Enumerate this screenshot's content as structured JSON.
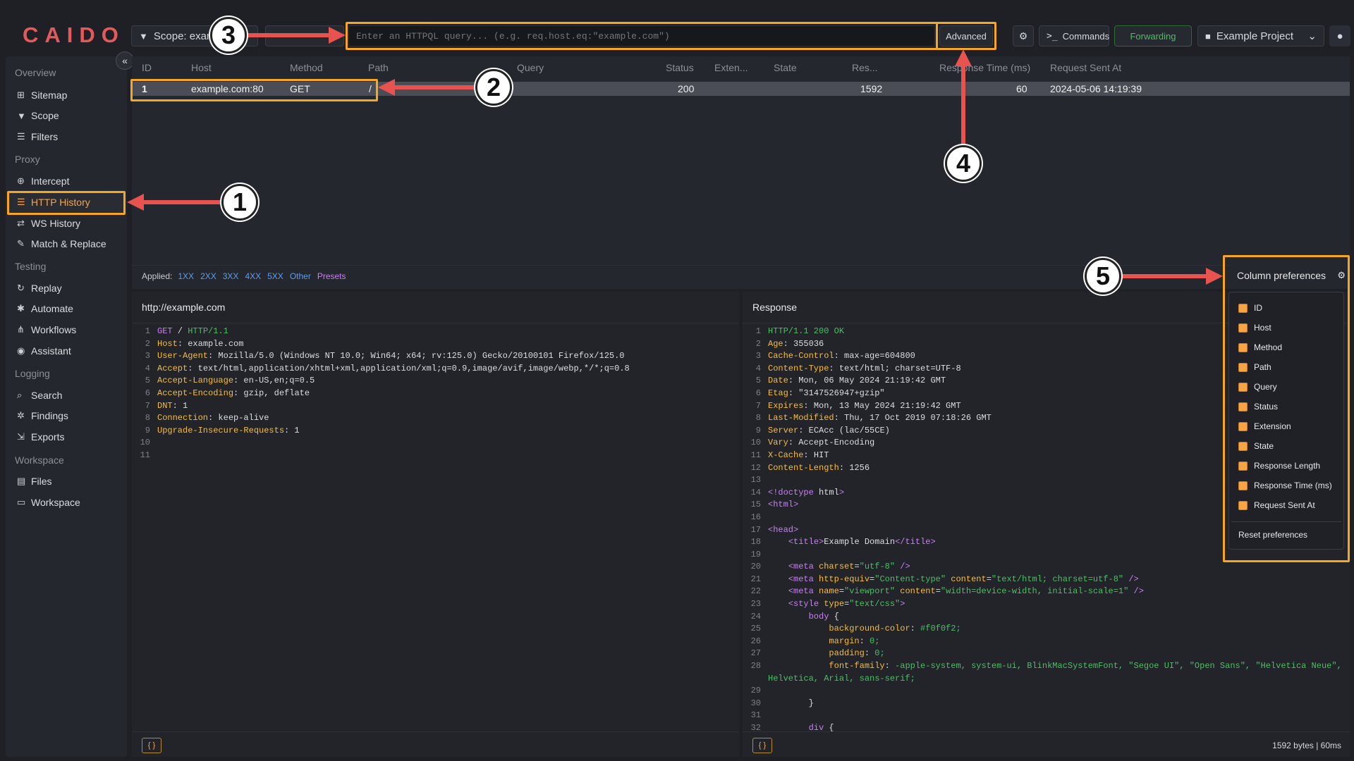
{
  "app": {
    "logo": "CAIDO"
  },
  "topbar": {
    "scope_label": "Scope: exam",
    "query_placeholder": "Enter an HTTPQL query... (e.g. req.host.eq:\"example.com\")",
    "advanced_label": "Advanced",
    "commands_label": "Commands",
    "forwarding_label": "Forwarding",
    "project_label": "Example Project"
  },
  "sidebar": {
    "sections": [
      {
        "title": "Overview",
        "items": [
          "Sitemap",
          "Scope",
          "Filters"
        ]
      },
      {
        "title": "Proxy",
        "items": [
          "Intercept",
          "HTTP History",
          "WS History",
          "Match & Replace"
        ]
      },
      {
        "title": "Testing",
        "items": [
          "Replay",
          "Automate",
          "Workflows",
          "Assistant"
        ]
      },
      {
        "title": "Logging",
        "items": [
          "Search",
          "Findings",
          "Exports"
        ]
      },
      {
        "title": "Workspace",
        "items": [
          "Files",
          "Workspace"
        ]
      }
    ],
    "active_item": "HTTP History"
  },
  "table": {
    "columns": [
      "ID",
      "Host",
      "Method",
      "Path",
      "Query",
      "Status",
      "Exten...",
      "State",
      "Res...",
      "Response Time (ms)",
      "Request Sent At"
    ],
    "rows": [
      {
        "id": "1",
        "host": "example.com:80",
        "method": "GET",
        "path": "/",
        "query": "",
        "status": "200",
        "extension": "",
        "state": "",
        "response_length": "1592",
        "response_time": "60",
        "sent_at": "2024-05-06 14:19:39"
      }
    ]
  },
  "applied": {
    "label": "Applied:",
    "chips": [
      "1XX",
      "2XX",
      "3XX",
      "4XX",
      "5XX",
      "Other"
    ],
    "presets": "Presets"
  },
  "request": {
    "title": "http://example.com",
    "lines": [
      [
        "GET",
        " / ",
        "HTTP/1.1"
      ],
      [
        "Host",
        ": example.com"
      ],
      [
        "User-Agent",
        ": Mozilla/5.0 (Windows NT 10.0; Win64; x64; rv:125.0) Gecko/20100101 Firefox/125.0"
      ],
      [
        "Accept",
        ": text/html,application/xhtml+xml,application/xml;q=0.9,image/avif,image/webp,*/*;q=0.8"
      ],
      [
        "Accept-Language",
        ": en-US,en;q=0.5"
      ],
      [
        "Accept-Encoding",
        ": gzip, deflate"
      ],
      [
        "DNT",
        ": 1"
      ],
      [
        "Connection",
        ": keep-alive"
      ],
      [
        "Upgrade-Insecure-Requests",
        ": 1"
      ],
      [
        ""
      ],
      [
        ""
      ]
    ]
  },
  "response": {
    "title": "Response",
    "stats": "1592 bytes  |  60ms",
    "header_lines": [
      [
        "HTTP/1.1 200 OK",
        ""
      ],
      [
        "Age",
        ": 355036"
      ],
      [
        "Cache-Control",
        ": max-age=604800"
      ],
      [
        "Content-Type",
        ": text/html; charset=UTF-8"
      ],
      [
        "Date",
        ": Mon, 06 May 2024 21:19:42 GMT"
      ],
      [
        "Etag",
        ": \"3147526947+gzip\""
      ],
      [
        "Expires",
        ": Mon, 13 May 2024 21:19:42 GMT"
      ],
      [
        "Last-Modified",
        ": Thu, 17 Oct 2019 07:18:26 GMT"
      ],
      [
        "Server",
        ": ECAcc (lac/55CE)"
      ],
      [
        "Vary",
        ": Accept-Encoding"
      ],
      [
        "X-Cache",
        ": HIT"
      ],
      [
        "Content-Length",
        ": 1256"
      ]
    ],
    "body_lines": [
      "",
      "<!doctype html>",
      "<html>",
      "",
      "<head>",
      "    <title>Example Domain</title>",
      "",
      "    <meta charset=\"utf-8\" />",
      "    <meta http-equiv=\"Content-type\" content=\"text/html; charset=utf-8\" />",
      "    <meta name=\"viewport\" content=\"width=device-width, initial-scale=1\" />",
      "    <style type=\"text/css\">",
      "        body {",
      "            background-color: #f0f0f2;",
      "            margin: 0;",
      "            padding: 0;",
      "            font-family: -apple-system, system-ui, BlinkMacSystemFont, \"Segoe UI\", \"Open Sans\", \"Helvetica Neue\",",
      "Helvetica, Arial, sans-serif;",
      "",
      "        }",
      "",
      "        div {"
    ],
    "body_numbers": [
      "13",
      "14",
      "15",
      "16",
      "17",
      "18",
      "19",
      "20",
      "21",
      "22",
      "23",
      "24",
      "25",
      "26",
      "27",
      "28",
      "",
      "29",
      "30",
      "31",
      "32"
    ]
  },
  "column_preferences": {
    "title": "Column preferences",
    "items": [
      "ID",
      "Host",
      "Method",
      "Path",
      "Query",
      "Status",
      "Extension",
      "State",
      "Response Length",
      "Response Time (ms)",
      "Request Sent At"
    ],
    "reset_label": "Reset preferences"
  },
  "annotations": [
    "1",
    "2",
    "3",
    "4",
    "5"
  ],
  "colors": {
    "accent": "#f5a623",
    "arrow": "#e8534f",
    "forwarding": "#4cbf62"
  }
}
